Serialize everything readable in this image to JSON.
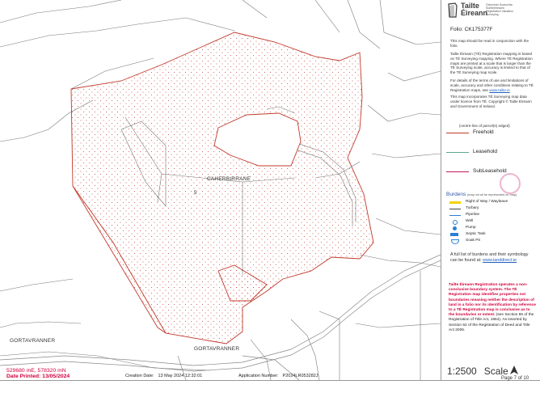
{
  "logo": {
    "name_line1": "Tailte",
    "name_line2": "Éireann",
    "sub_lines": [
      "Clárúchán Suaíochta",
      "Suirbhéireacht",
      "Registration Valuation",
      "Surveying"
    ]
  },
  "folio": "Folio: CK175377F",
  "notes": {
    "p1": "This map should be read in conjunction with the folio.",
    "p2": "Tailte Éireann (TÉ) Registration mapping is based on TÉ Surveying mapping. Where TÉ Registration maps are printed at a scale that is larger than the TÉ Surveying scale, accuracy is limited to that of the TÉ Surveying map scale.",
    "p3": "For details of the terms of use and limitations of scale, accuracy and other conditions relating to TÉ Registration maps, see",
    "p3_link": "www.tailte.ie",
    "p4": "This map incorporates TÉ Surveying map data under licence from TÉ. Copyright © Tailte Éireann and Government of Ireland."
  },
  "legend": {
    "title": "(centre-line of parcel(s) edged)",
    "items": [
      {
        "label": "Freehold",
        "color": "#c0392b"
      },
      {
        "label": "Leasehold",
        "color": "#5fa890"
      },
      {
        "label": "SubLeasehold",
        "color": "#c2185b"
      }
    ]
  },
  "burdens": {
    "title": "Burdens",
    "note": "(may not all be represented on map)",
    "items": [
      {
        "label": "Right of Way / Wayleave",
        "color": "#f2d200"
      },
      {
        "label": "Turbary",
        "color": "#444444"
      },
      {
        "label": "Pipeline",
        "color": "#2a7fd4"
      },
      {
        "label": "Well",
        "color": "#2a7fd4"
      },
      {
        "label": "Pump",
        "color": "#2a7fd4"
      },
      {
        "label": "Septic Tank",
        "color": "#2a7fd4"
      },
      {
        "label": "Soak Pit",
        "color": "#2a7fd4"
      }
    ],
    "list_note": "A full list of burdens and their symbology can be found at:",
    "list_link": "www.landdirect.ie"
  },
  "warning": {
    "bold": "Tailte Éireann Registration operates a non-conclusive boundary system. The TÉ Registration map identifies properties not boundaries meaning neither the description of land in a folio nor its identification by reference to a TÉ Registration map is conclusive as to the boundaries or extent.",
    "rest": "(see Section 85 of the Registration of Title Act, 1964). As inserted by Section 62 of the Registration of Deed and Title Act 2006."
  },
  "map": {
    "townland": "CAHERBIRRANE",
    "parcel_number": "5",
    "place_left": "GORTAVRANNER",
    "place_bottom": "GORTAVRANNER"
  },
  "footer": {
    "coords": "529680 mE, 578320 mN",
    "date_printed": "Date Printed: 13/05/2024",
    "creation_label": "Creation Date:",
    "creation_value": "13 May 2024 12:32:01",
    "application_label": "Application Number:",
    "application_value": "P2024LR053282J",
    "scale_ratio": "1:2500",
    "scale_word": "Scale",
    "page": "Page 7 of 10"
  }
}
